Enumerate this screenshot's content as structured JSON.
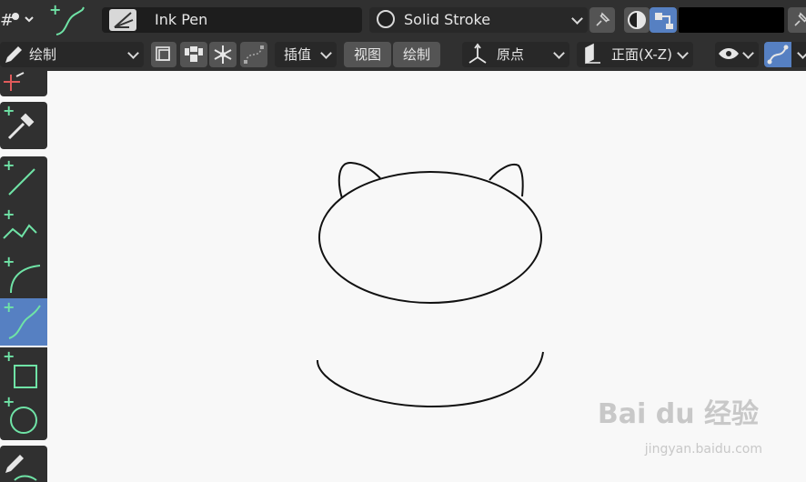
{
  "header": {
    "brush_name": "Ink Pen",
    "material_name": "Solid Stroke"
  },
  "toolbar2": {
    "mode_label": "绘制",
    "interpolate_label": "插值",
    "view_label": "视图",
    "draw_label": "绘制",
    "origin_label": "原点",
    "view_plane_label": "正面(X-Z)"
  },
  "tools": [
    {
      "name": "cursor",
      "active": false
    },
    {
      "name": "eyedropper",
      "active": false
    },
    {
      "name": "line",
      "active": false
    },
    {
      "name": "polyline",
      "active": false
    },
    {
      "name": "arc",
      "active": false
    },
    {
      "name": "curve",
      "active": true
    },
    {
      "name": "box",
      "active": false
    },
    {
      "name": "circle",
      "active": false
    },
    {
      "name": "draw",
      "active": false
    }
  ],
  "colors": {
    "accent": "#5680c2",
    "tool_green": "#6fe3a6",
    "canvas": "#f8f8f8",
    "header": "#303030"
  },
  "watermark": {
    "brand": "Bai du 经验",
    "url": "jingyan.baidu.com"
  }
}
